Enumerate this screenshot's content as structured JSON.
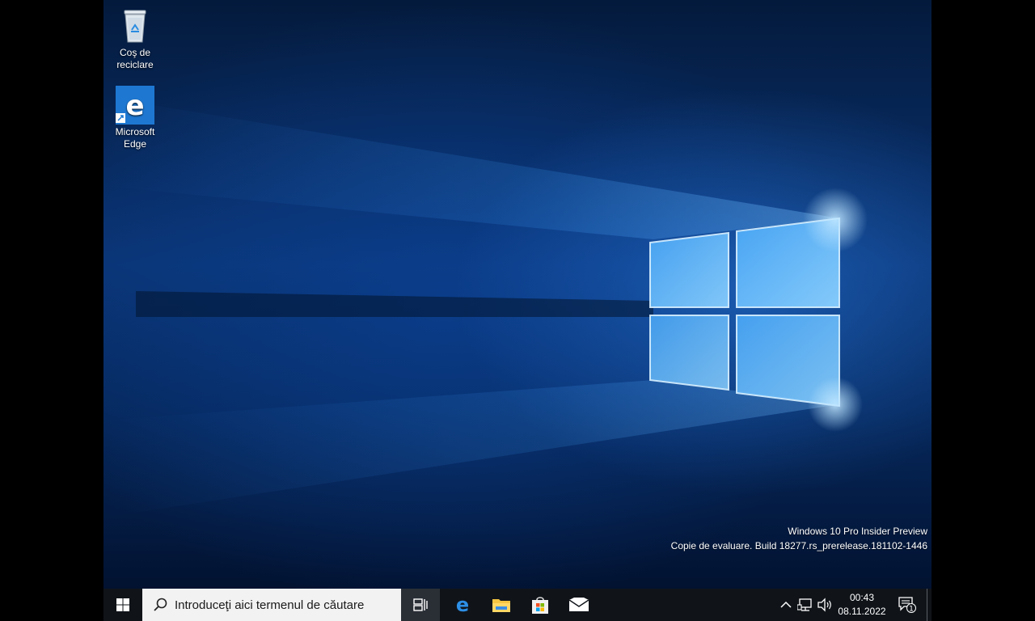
{
  "desktop": {
    "icons": [
      {
        "label_line1": "Coş de",
        "label_line2": "reciclare",
        "icon": "recycle-bin-icon"
      },
      {
        "label_line1": "Microsoft",
        "label_line2": "Edge",
        "icon": "edge-icon"
      }
    ],
    "watermark": {
      "line1": "Windows 10 Pro Insider Preview",
      "line2": "Copie de evaluare. Build 18277.rs_prerelease.181102-1446"
    }
  },
  "taskbar": {
    "start_icon": "windows-logo-icon",
    "search_placeholder": "Introduceţi aici termenul de căutare",
    "task_view_icon": "task-view-icon",
    "pinned": [
      {
        "name": "Microsoft Edge",
        "icon": "edge-icon"
      },
      {
        "name": "File Explorer",
        "icon": "folder-icon"
      },
      {
        "name": "Microsoft Store",
        "icon": "store-icon"
      },
      {
        "name": "Mail",
        "icon": "mail-icon"
      }
    ],
    "tray": {
      "icons": [
        "chevron-up-icon",
        "network-icon",
        "volume-icon"
      ],
      "time": "00:43",
      "date": "08.11.2022",
      "notifications_count": "1"
    }
  },
  "colors": {
    "taskbar_bg": "#101419",
    "accent_blue": "#0078d7",
    "search_bg": "#f2f2f2"
  }
}
